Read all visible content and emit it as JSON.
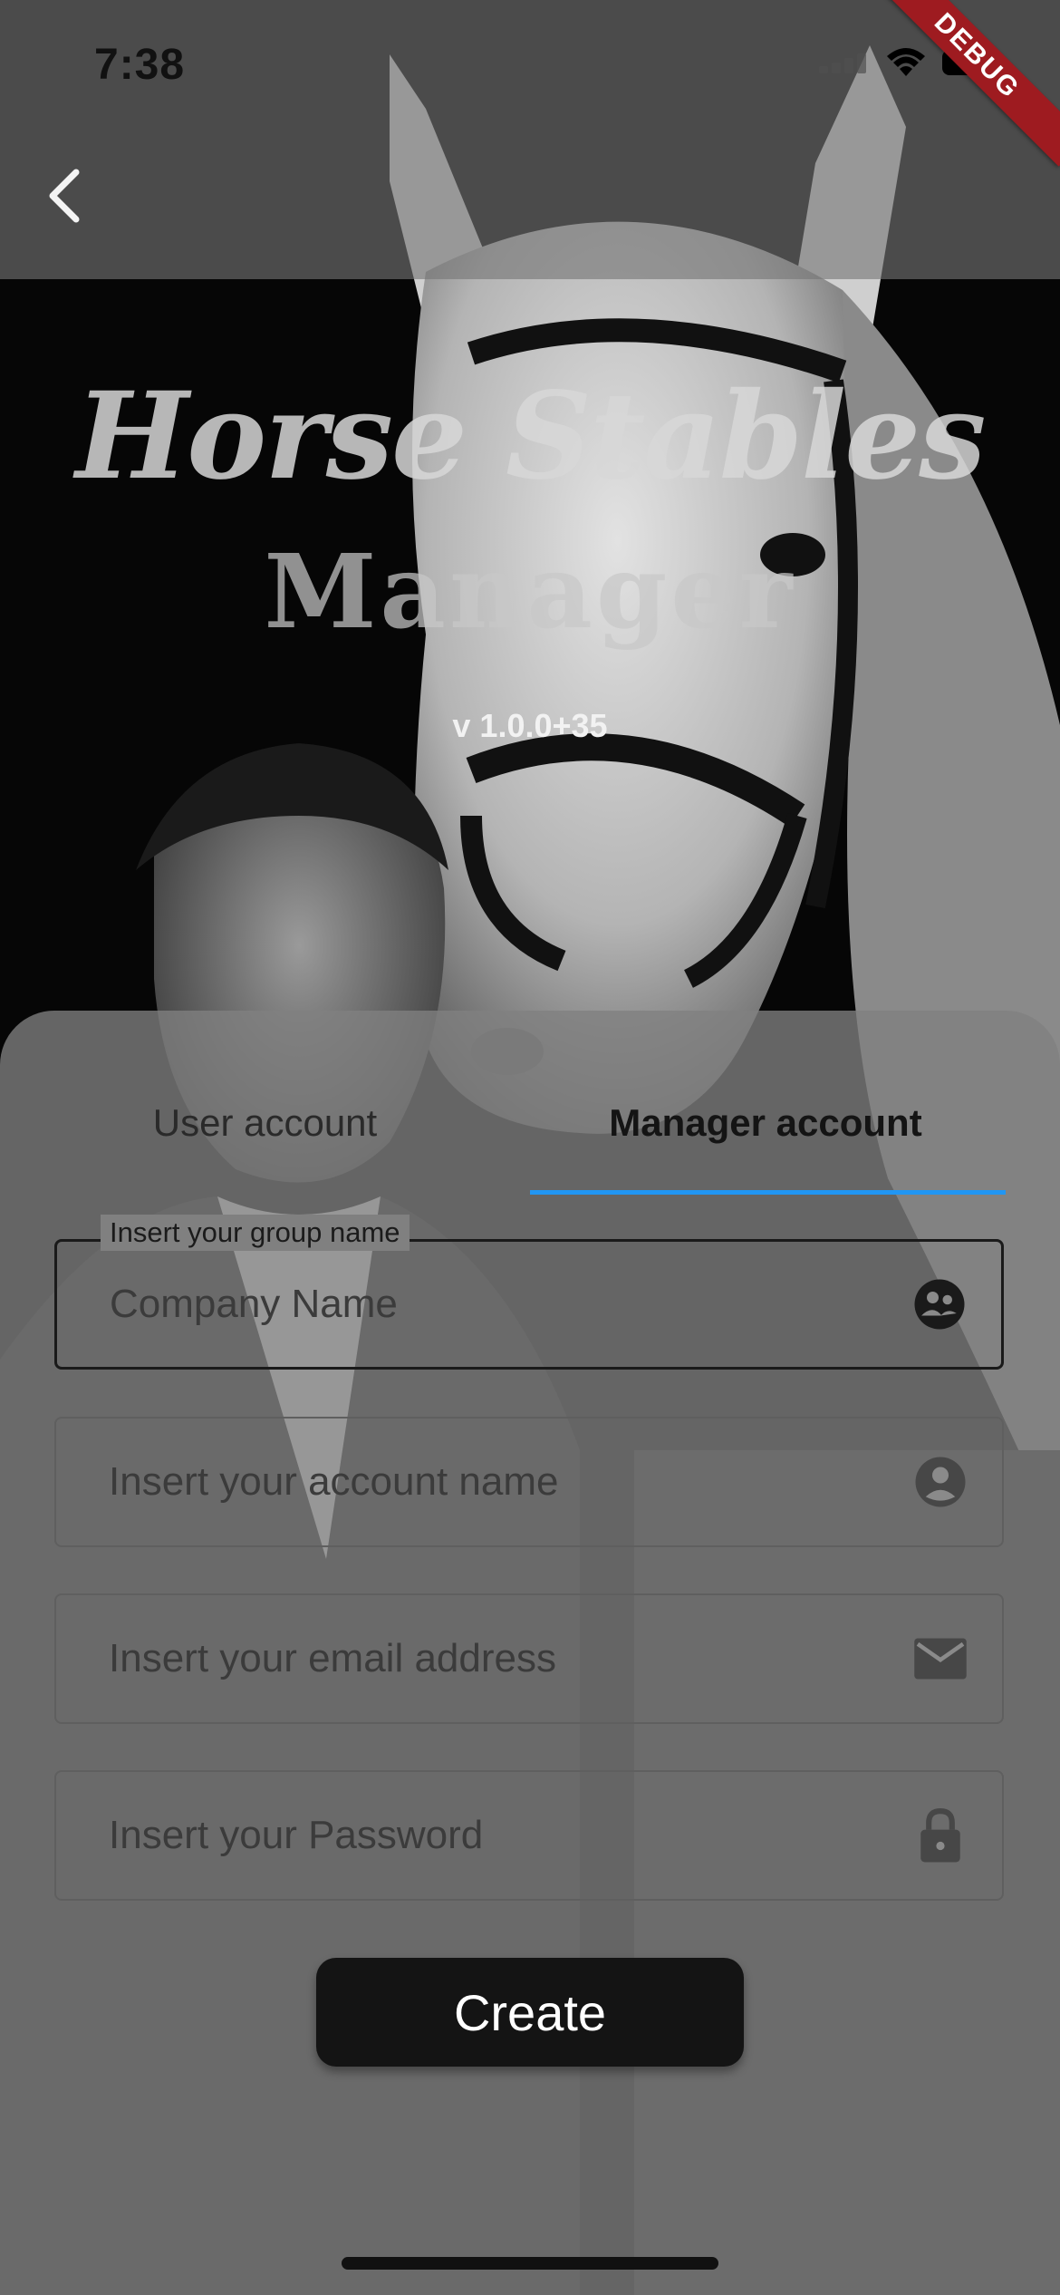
{
  "status_bar": {
    "time": "7:38",
    "icons": [
      "cellular-signal-icon",
      "wifi-icon",
      "battery-icon"
    ]
  },
  "debug_banner": "DEBUG",
  "app_bar": {
    "back_icon": "chevron-left-icon"
  },
  "header": {
    "title_line1": "Horse Stables",
    "title_line2": "Manager",
    "version": "v 1.0.0+35"
  },
  "tabs": [
    {
      "label": "User account",
      "selected": false
    },
    {
      "label": "Manager account",
      "selected": true
    }
  ],
  "form": {
    "group_name": {
      "label": "Insert your group name",
      "placeholder": "Company Name",
      "icon": "group-icon"
    },
    "account_name": {
      "placeholder": "Insert your account name",
      "icon": "account-circle-icon"
    },
    "email": {
      "placeholder": "Insert your email address",
      "icon": "mail-icon"
    },
    "password": {
      "placeholder": "Insert your Password",
      "icon": "lock-icon"
    },
    "submit_label": "Create"
  },
  "colors": {
    "tab_indicator": "#2196f3",
    "button_bg": "#141414",
    "sheet_bg": "#808080",
    "debug_ribbon": "#9e1b20"
  }
}
